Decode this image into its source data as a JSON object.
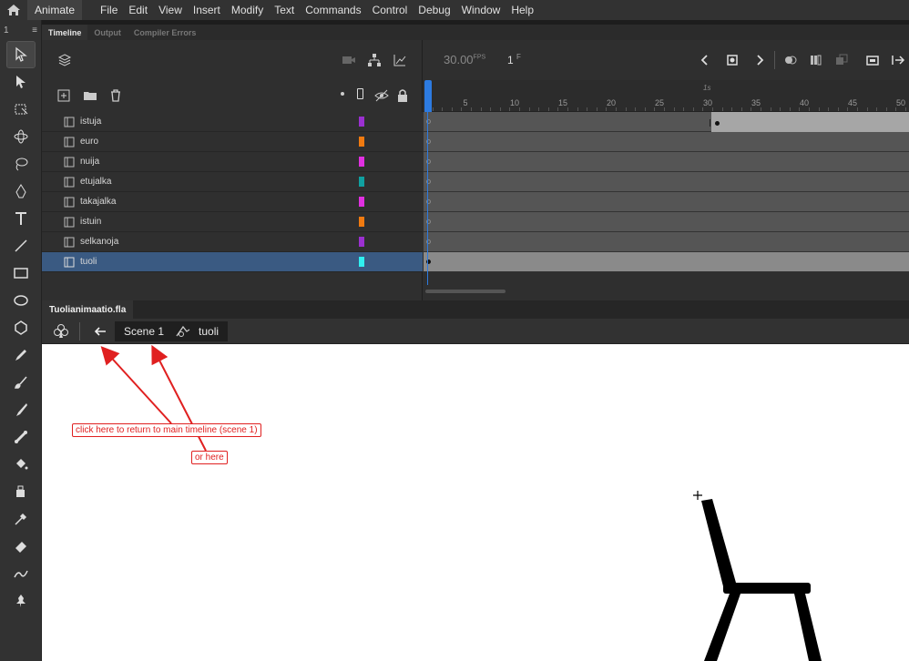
{
  "app": {
    "name": "Animate"
  },
  "menu": [
    "File",
    "Edit",
    "View",
    "Insert",
    "Modify",
    "Text",
    "Commands",
    "Control",
    "Debug",
    "Window",
    "Help"
  ],
  "toolbar": {
    "collapse_count": "1"
  },
  "panel_tabs": [
    "Timeline",
    "Output",
    "Compiler Errors"
  ],
  "timeline": {
    "fps": "30.00",
    "fps_unit": "FPS",
    "current_frame": "1",
    "frame_unit": "F",
    "ruler_second_label": "1s",
    "ruler_numbers": [
      "5",
      "10",
      "15",
      "20",
      "25",
      "30",
      "35",
      "40",
      "45",
      "50"
    ],
    "layers": [
      {
        "name": "istuja",
        "color": "#9b30d0"
      },
      {
        "name": "euro",
        "color": "#f07a10"
      },
      {
        "name": "nuija",
        "color": "#e030e0"
      },
      {
        "name": "etujalka",
        "color": "#10a0a0"
      },
      {
        "name": "takajalka",
        "color": "#e030e0"
      },
      {
        "name": "istuin",
        "color": "#f07a10"
      },
      {
        "name": "selkanoja",
        "color": "#9b30d0"
      },
      {
        "name": "tuoli",
        "color": "#30f0f0"
      }
    ]
  },
  "document": {
    "tab": "Tuolianimaatio.fla",
    "breadcrumb_scene": "Scene 1",
    "breadcrumb_symbol": "tuoli"
  },
  "annotations": {
    "note1": "click here to return to main timeline (scene 1)",
    "note2": "or here"
  },
  "colors": {
    "annotation": "#e02020",
    "selection": "#3a5a82",
    "playhead": "#2d7be0"
  }
}
